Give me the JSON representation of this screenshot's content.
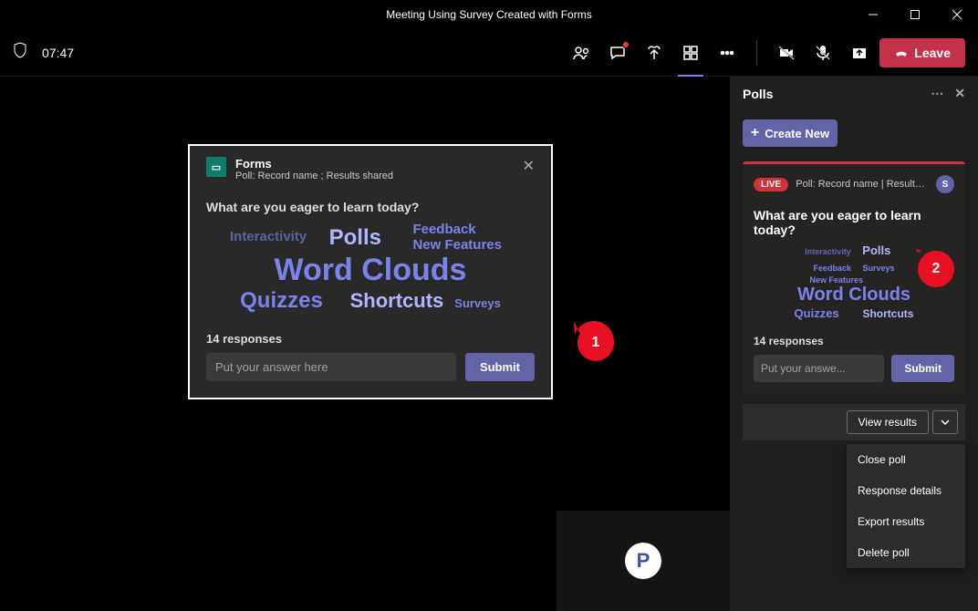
{
  "window": {
    "title": "Meeting Using Survey Created with Forms"
  },
  "toolbar": {
    "time": "07:47",
    "leave_label": "Leave"
  },
  "forms_card": {
    "app_name": "Forms",
    "subtitle": "Poll: Record name ; Results shared",
    "question": "What are you eager to learn today?",
    "responses_label": "14 responses",
    "input_placeholder": "Put your answer here",
    "submit_label": "Submit",
    "words": {
      "interactivity": "Interactivity",
      "polls": "Polls",
      "feedback": "Feedback",
      "new_features": "New Features",
      "word_clouds": "Word Clouds",
      "quizzes": "Quizzes",
      "shortcuts": "Shortcuts",
      "surveys": "Surveys"
    }
  },
  "callouts": {
    "one": "1",
    "two": "2"
  },
  "participant": {
    "avatar_letter": "P"
  },
  "polls_panel": {
    "title": "Polls",
    "create_label": "Create New",
    "live_label": "LIVE",
    "poll_meta": "Poll: Record name | Results s...",
    "avatar_letter": "S",
    "question": "What are you eager to learn today?",
    "responses_label": "14 responses",
    "input_placeholder": "Put your answe...",
    "submit_label": "Submit",
    "view_results_label": "View results",
    "menu": {
      "close_poll": "Close poll",
      "response_details": "Response details",
      "export_results": "Export results",
      "delete_poll": "Delete poll"
    },
    "words": {
      "interactivity": "Interactivity",
      "polls": "Polls",
      "feedback": "Feedback",
      "surveys": "Surveys",
      "new_features": "New Features",
      "word_clouds": "Word Clouds",
      "quizzes": "Quizzes",
      "shortcuts": "Shortcuts"
    }
  }
}
